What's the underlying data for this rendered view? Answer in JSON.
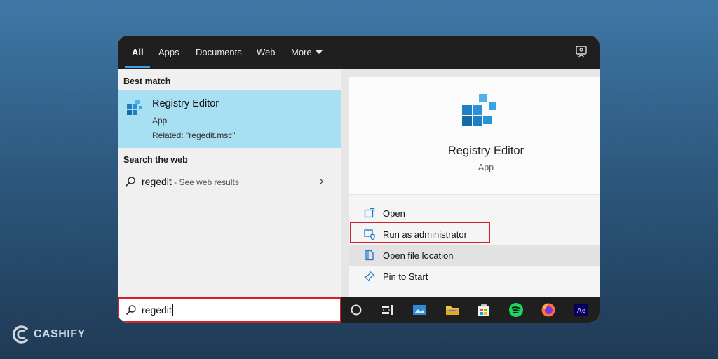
{
  "tabs": [
    {
      "label": "All"
    },
    {
      "label": "Apps"
    },
    {
      "label": "Documents"
    },
    {
      "label": "Web"
    },
    {
      "label": "More"
    }
  ],
  "left": {
    "best_match_heading": "Best match",
    "best_match": {
      "title": "Registry Editor",
      "type": "App",
      "related": "Related: \"regedit.msc\""
    },
    "search_web_heading": "Search the web",
    "web_result": {
      "query": "regedit",
      "hint": " - See web results"
    }
  },
  "preview": {
    "title": "Registry Editor",
    "type": "App",
    "actions": [
      {
        "label": "Open",
        "icon": "open-icon"
      },
      {
        "label": "Run as administrator",
        "icon": "shield-window-icon"
      },
      {
        "label": "Open file location",
        "icon": "folder-location-icon"
      },
      {
        "label": "Pin to Start",
        "icon": "pin-icon"
      }
    ]
  },
  "search": {
    "value": "regedit"
  },
  "taskbar": {
    "icons": [
      "cortana-icon",
      "task-view-icon",
      "photos-icon",
      "file-explorer-icon",
      "store-icon",
      "spotify-icon",
      "firefox-icon",
      "after-effects-icon"
    ],
    "ae_label": "Ae"
  },
  "watermark": {
    "text": "CASHIFY"
  },
  "colors": {
    "accent": "#3f9ee8",
    "selection": "#a8dff2",
    "highlight_border": "#d81e2a"
  }
}
